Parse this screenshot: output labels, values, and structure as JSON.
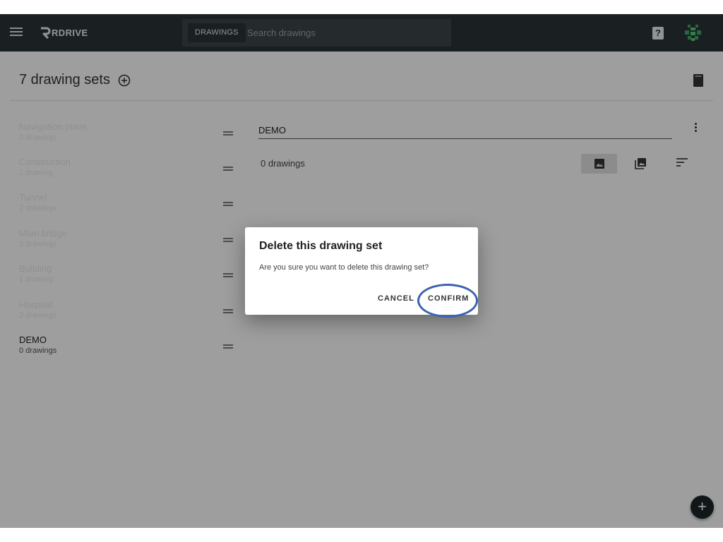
{
  "header": {
    "brand": "RDRIVE",
    "search_chip": "DRAWINGS",
    "search_placeholder": "Search drawings",
    "help_glyph": "?"
  },
  "page": {
    "title": "7 drawing sets"
  },
  "sets": [
    {
      "name": "Navigation plans",
      "count": "0 drawings",
      "faded": true
    },
    {
      "name": "Construction",
      "count": "1 drawing",
      "faded": true
    },
    {
      "name": "Tunnel",
      "count": "2 drawings",
      "faded": true
    },
    {
      "name": "Main bridge",
      "count": "3 drawings",
      "faded": true
    },
    {
      "name": "Building",
      "count": "1 drawing",
      "faded": true
    },
    {
      "name": "Hospital",
      "count": "2 drawings",
      "faded": true
    },
    {
      "name": "DEMO",
      "count": "0 drawings",
      "faded": false
    }
  ],
  "detail": {
    "set_name": "DEMO",
    "drawing_count": "0 drawings"
  },
  "fab": {
    "glyph": "+"
  },
  "dialog": {
    "title": "Delete this drawing set",
    "message": "Are you sure you want to delete this drawing set?",
    "cancel_label": "CANCEL",
    "confirm_label": "CONFIRM"
  },
  "icons": {
    "menu": "menu-icon",
    "logo": "rdrive-logo-icon",
    "help": "help-icon",
    "avatar": "avatar-icon",
    "add_set": "add-circle-icon",
    "book": "book-icon",
    "kebab": "more-vert-icon",
    "single_view": "image-icon",
    "multi_view": "image-stack-icon",
    "sort": "sort-icon",
    "drag": "drag-handle-icon"
  },
  "colors": {
    "topbar": "#2a3236",
    "search_bg": "#3a4246",
    "highlight_ring": "#3a63b0",
    "avatar": "#3fa062"
  }
}
